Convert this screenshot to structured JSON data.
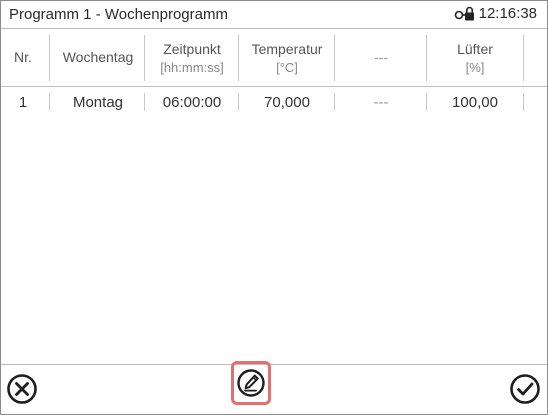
{
  "titlebar": {
    "title": "Programm 1 - Wochenprogramm",
    "time": "12:16:38",
    "lock_icon": "lock-key-icon"
  },
  "table": {
    "columns": [
      {
        "line1": "Nr.",
        "line2": ""
      },
      {
        "line1": "Wochentag",
        "line2": ""
      },
      {
        "line1": "Zeitpunkt",
        "line2": "[hh:mm:ss]"
      },
      {
        "line1": "Temperatur",
        "line2": "[°C]"
      },
      {
        "line1": "---",
        "line2": ""
      },
      {
        "line1": "Lüfter",
        "line2": "[%]"
      }
    ],
    "rows": [
      [
        "1",
        "Montag",
        "06:00:00",
        "70,000",
        "---",
        "100,00"
      ]
    ]
  },
  "footer": {
    "cancel_icon": "close-circle-icon",
    "edit_icon": "edit-pencil-icon",
    "confirm_icon": "check-circle-icon"
  },
  "colors": {
    "highlight": "#e36f6f",
    "border": "#bdbdbd"
  }
}
